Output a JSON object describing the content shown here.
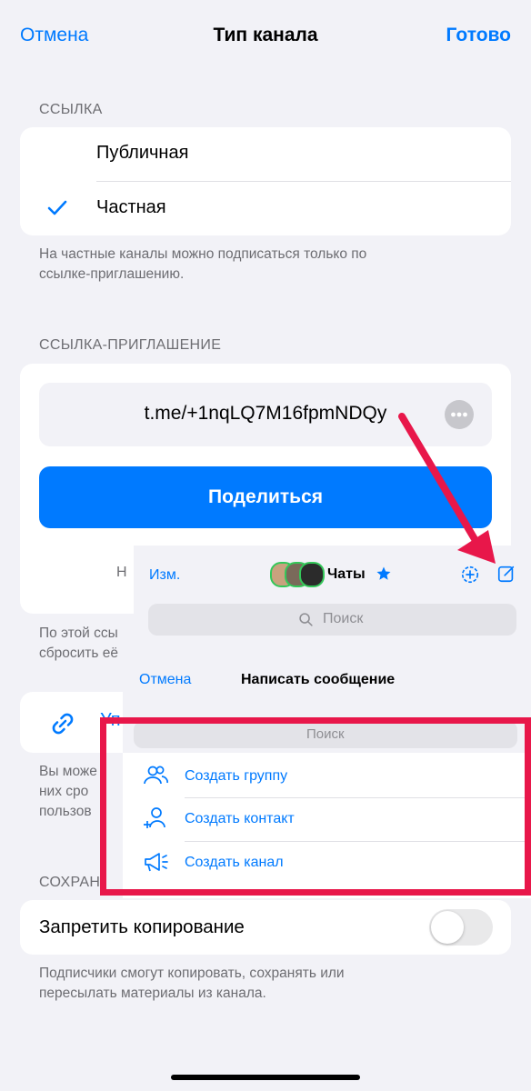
{
  "nav": {
    "cancel": "Отмена",
    "title": "Тип канала",
    "done": "Готово"
  },
  "link_section": {
    "header": "ССЫЛКА",
    "options": [
      {
        "label": "Публичная",
        "checked": false
      },
      {
        "label": "Частная",
        "checked": true
      }
    ],
    "note": [
      "На частные каналы можно подписаться только по",
      "ссылке-приглашению."
    ]
  },
  "invite_section": {
    "header": "ССЫЛКА-ПРИГЛАШЕНИЕ",
    "link": "t.me/+1nqLQ7M16fpmNDQy",
    "share_label": "Поделиться",
    "partial_row": "Н",
    "note": [
      "По этой ссы",
      "сбросить её"
    ]
  },
  "manage_row": {
    "label_partial": "Уп"
  },
  "manage_note": [
    "Вы може",
    "них сро",
    "пользов"
  ],
  "save_section": {
    "header_partial": "СОХРАН",
    "toggle_label": "Запретить копирование",
    "toggle_on": false,
    "note": [
      "Подписчики смогут копировать, сохранять или",
      "пересылать материалы из канала."
    ]
  },
  "overlay": {
    "edit": "Изм.",
    "title": "Чаты",
    "search_placeholder": "Поиск",
    "cancel": "Отмена",
    "compose_title": "Написать сообщение",
    "search_placeholder_2": "Поиск",
    "actions": [
      {
        "label": "Создать группу",
        "icon": "group-icon"
      },
      {
        "label": "Создать контакт",
        "icon": "add-contact-icon"
      },
      {
        "label": "Создать канал",
        "icon": "megaphone-icon"
      }
    ]
  },
  "colors": {
    "accent": "#007aff",
    "annotation": "#e8174a",
    "background": "#f2f2f7"
  }
}
